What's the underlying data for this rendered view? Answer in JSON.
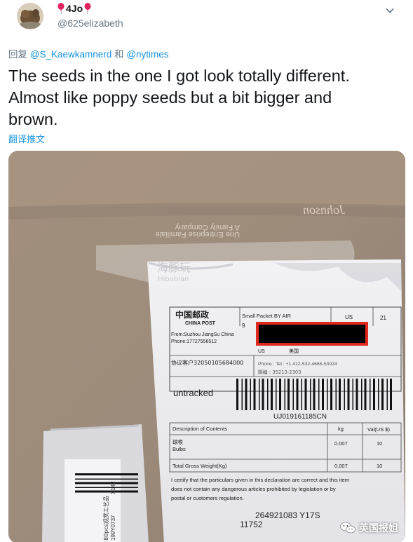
{
  "tweet": {
    "display_name": "4Jo",
    "handle": "@625elizabeth",
    "reply_prefix": "回复",
    "reply_mention_1": "@S_Kaewkamnerd",
    "reply_and": "和",
    "reply_mention_2": "@nytimes",
    "text_line_1": "The seeds in the one I got look totally different.",
    "text_line_2": "Almost like poppy seeds but a bit bigger and",
    "text_line_3": "brown.",
    "translate_label": "翻译推文"
  },
  "photo": {
    "brand_text": "Johnson",
    "family_company": "A Family Company",
    "family_company_fr": "Une Entreprise Familiale",
    "faded_logo": "海豚玩",
    "faded_logo_en": "Hibobian",
    "label": {
      "post_cn": "中国邮政",
      "post_en": "CHINA POST",
      "service": "Small Packet BY AIR",
      "country_box": "US",
      "zone_box": "21",
      "number_9": "9",
      "from": "From:Suzhou JiangSu China",
      "phone": "Phone:17727556512",
      "to_country": "US",
      "to_country_cn": "美国",
      "customer_no": "协议客户32050105684000",
      "phone_redacted": "Phone : Tel : +1 412-532-4665-53024",
      "postcode": "邮编 : 35213-2303",
      "untracked": "untracked",
      "tracking_no": "UJ019161185CN",
      "contents_header": "Description of Contents",
      "kg_header": "kg",
      "val_header": "Val(US $)",
      "item_cn": "球根",
      "item_en": "Bulbs",
      "item_kg": "0.007",
      "item_val": "10",
      "total_label": "Total Gross Weight(Kg)",
      "total_kg": "0.007",
      "total_val": "10",
      "certify_1": "I certify that the particulars given in this declaration are correct and this item",
      "certify_2": "does not contain any dangerous articles prohibited by legislation or by",
      "certify_3": "postal or customers regulation.",
      "bottom_code": "264921083 Y17S",
      "bottom_code_2": "11752"
    },
    "side_packet": {
      "line_1": "80pcs观赏工艺品",
      "line_2": "199Y0737",
      "line_3": "X142"
    },
    "watermark_text": "英国报姐"
  },
  "colors": {
    "link_blue": "#1b95e0",
    "text_dark": "#14171a",
    "text_gray": "#657786",
    "redaction_border": "#e0281d"
  }
}
